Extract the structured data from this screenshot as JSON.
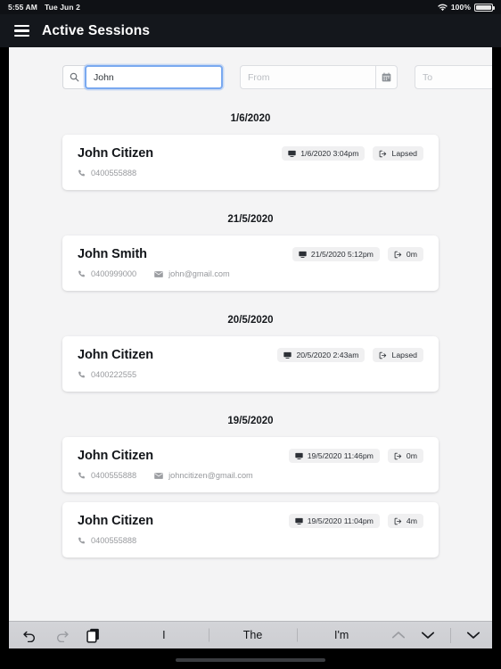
{
  "status_bar": {
    "time": "5:55 AM",
    "date": "Tue Jun 2",
    "wifi_icon": "wifi-icon",
    "battery_percent": "100%"
  },
  "appbar": {
    "menu_icon": "hamburger-menu-icon",
    "title": "Active Sessions"
  },
  "filters": {
    "search": {
      "icon": "search-icon",
      "value": "John",
      "placeholder": ""
    },
    "date_from": {
      "placeholder": "From",
      "value": "",
      "icon": "calendar-icon"
    },
    "date_to": {
      "placeholder": "To",
      "value": "",
      "icon": "calendar-icon"
    }
  },
  "colors": {
    "appbar_bg": "#14171c",
    "page_bg": "#f4f4f5",
    "card_bg": "#ffffff",
    "badge_bg": "#f0f0f1",
    "focus_ring": "#7aa9f0",
    "muted_text": "#97999d"
  },
  "groups": [
    {
      "date": "1/6/2020",
      "sessions": [
        {
          "name": "John Citizen",
          "timestamp": "1/6/2020 3:04pm",
          "timestamp_icon": "desktop-icon",
          "duration": "Lapsed",
          "duration_icon": "sign-out-icon",
          "phone": "0400555888",
          "phone_icon": "phone-icon",
          "email": "",
          "email_icon": "envelope-icon"
        }
      ]
    },
    {
      "date": "21/5/2020",
      "sessions": [
        {
          "name": "John Smith",
          "timestamp": "21/5/2020 5:12pm",
          "timestamp_icon": "desktop-icon",
          "duration": "0m",
          "duration_icon": "sign-out-icon",
          "phone": "0400999000",
          "phone_icon": "phone-icon",
          "email": "john@gmail.com",
          "email_icon": "envelope-icon"
        }
      ]
    },
    {
      "date": "20/5/2020",
      "sessions": [
        {
          "name": "John Citizen",
          "timestamp": "20/5/2020 2:43am",
          "timestamp_icon": "desktop-icon",
          "duration": "Lapsed",
          "duration_icon": "sign-out-icon",
          "phone": "0400222555",
          "phone_icon": "phone-icon",
          "email": "",
          "email_icon": "envelope-icon"
        }
      ]
    },
    {
      "date": "19/5/2020",
      "sessions": [
        {
          "name": "John Citizen",
          "timestamp": "19/5/2020 11:46pm",
          "timestamp_icon": "desktop-icon",
          "duration": "0m",
          "duration_icon": "sign-out-icon",
          "phone": "0400555888",
          "phone_icon": "phone-icon",
          "email": "johncitizen@gmail.com",
          "email_icon": "envelope-icon"
        },
        {
          "name": "John Citizen",
          "timestamp": "19/5/2020 11:04pm",
          "timestamp_icon": "desktop-icon",
          "duration": "4m",
          "duration_icon": "sign-out-icon",
          "phone": "0400555888",
          "phone_icon": "phone-icon",
          "email": "",
          "email_icon": "envelope-icon"
        }
      ]
    }
  ],
  "keyboard_toolbar": {
    "undo_icon": "undo-arrow-icon",
    "redo_icon": "redo-arrow-icon",
    "paste_icon": "copy-paste-icon",
    "predictions": [
      "I",
      "The",
      "I'm"
    ],
    "prev_icon": "chevron-up-icon",
    "next_icon": "chevron-down-icon",
    "dismiss_icon": "chevron-down-dismiss-icon"
  }
}
